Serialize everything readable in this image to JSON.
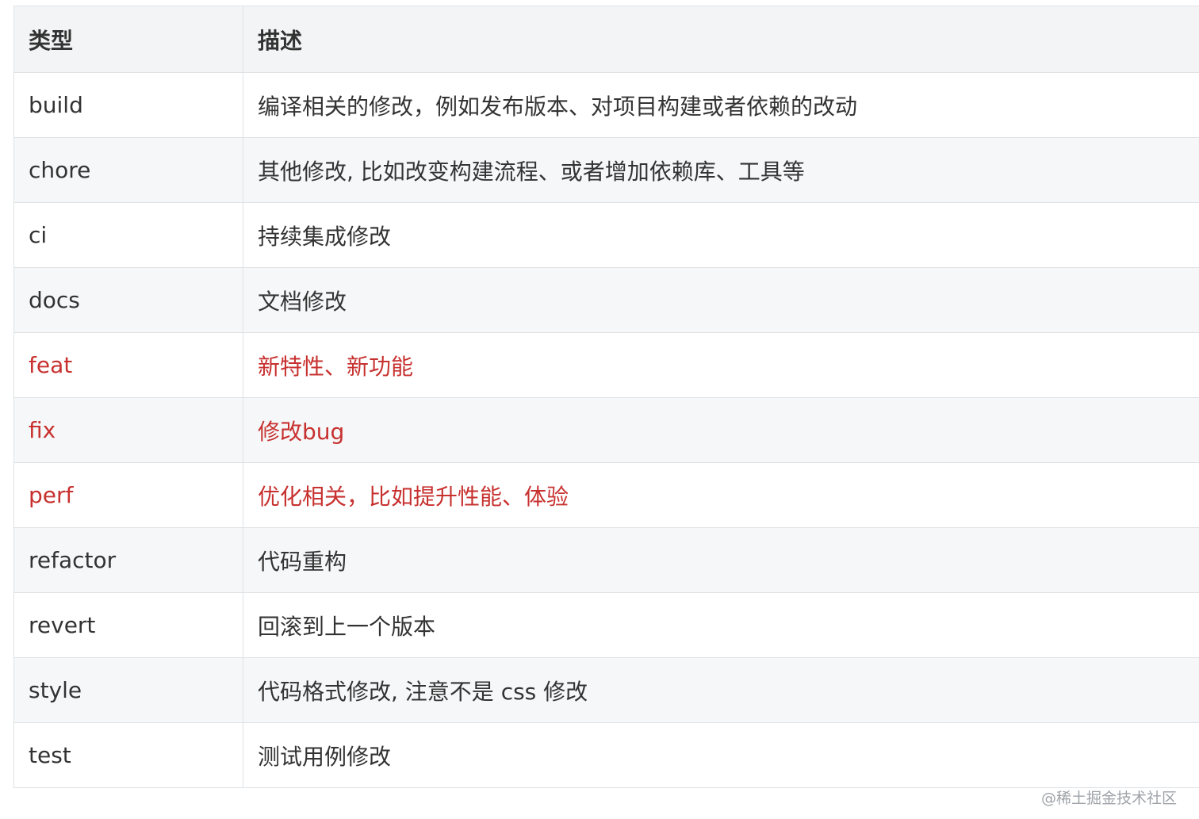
{
  "table": {
    "headers": {
      "type": "类型",
      "description": "描述"
    },
    "rows": [
      {
        "type": "build",
        "description": "编译相关的修改，例如发布版本、对项目构建或者依赖的改动",
        "highlight": false
      },
      {
        "type": "chore",
        "description": "其他修改, 比如改变构建流程、或者增加依赖库、工具等",
        "highlight": false
      },
      {
        "type": "ci",
        "description": "持续集成修改",
        "highlight": false
      },
      {
        "type": "docs",
        "description": "文档修改",
        "highlight": false
      },
      {
        "type": "feat",
        "description": "新特性、新功能",
        "highlight": true
      },
      {
        "type": "fix",
        "description": "修改bug",
        "highlight": true
      },
      {
        "type": "perf",
        "description": "优化相关，比如提升性能、体验",
        "highlight": true
      },
      {
        "type": "refactor",
        "description": "代码重构",
        "highlight": false
      },
      {
        "type": "revert",
        "description": "回滚到上一个版本",
        "highlight": false
      },
      {
        "type": "style",
        "description": "代码格式修改, 注意不是 css 修改",
        "highlight": false
      },
      {
        "type": "test",
        "description": "测试用例修改",
        "highlight": false
      }
    ]
  },
  "colors": {
    "highlight_text": "#c7312f",
    "normal_text": "#333333",
    "header_bg": "#f3f4f5",
    "border": "#dfe2e5"
  },
  "watermark": "@稀土掘金技术社区"
}
